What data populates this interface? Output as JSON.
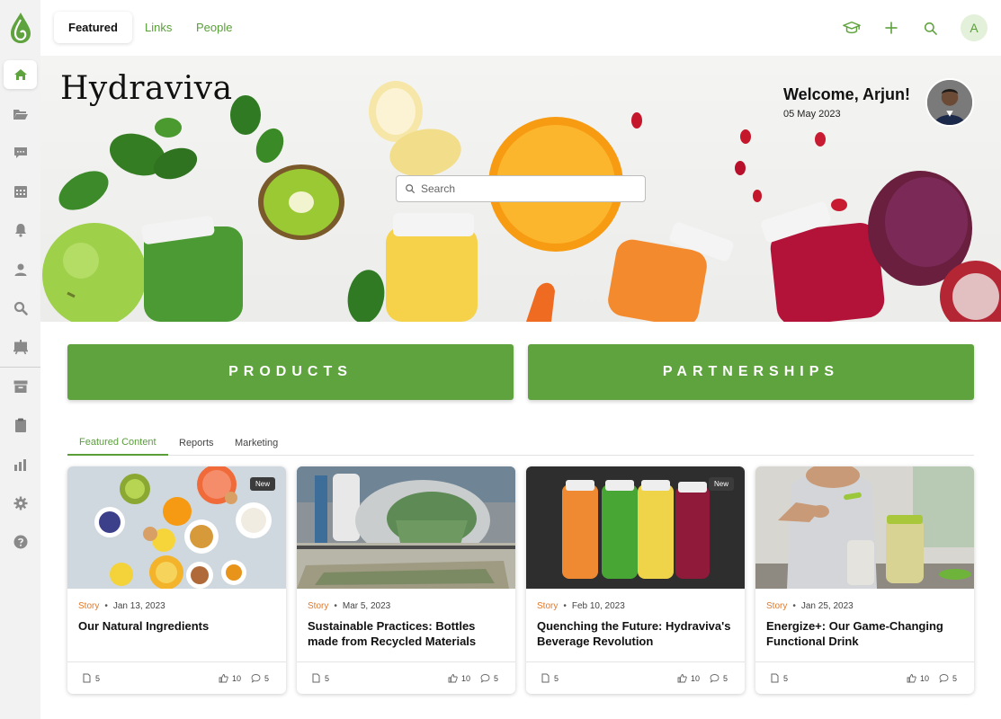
{
  "topbar": {
    "tabs": [
      {
        "label": "Featured"
      },
      {
        "label": "Links"
      },
      {
        "label": "People"
      }
    ],
    "avatar_initial": "A"
  },
  "hero": {
    "brand": "Hydraviva",
    "welcome": "Welcome, Arjun!",
    "date": "05 May 2023",
    "search_placeholder": "Search"
  },
  "buttons": {
    "products": "PRODUCTS",
    "partnerships": "PARTNERSHIPS"
  },
  "content_tabs": [
    {
      "label": "Featured Content"
    },
    {
      "label": "Reports"
    },
    {
      "label": "Marketing"
    }
  ],
  "cards": [
    {
      "type": "Story",
      "date": "Jan 13, 2023",
      "title": "Our Natural Ingredients",
      "badge": "New",
      "docs": "5",
      "likes": "10",
      "comments": "5"
    },
    {
      "type": "Story",
      "date": "Mar 5, 2023",
      "title": "Sustainable Practices: Bottles made from Recycled Materials",
      "badge": "",
      "docs": "5",
      "likes": "10",
      "comments": "5"
    },
    {
      "type": "Story",
      "date": "Feb 10, 2023",
      "title": "Quenching the Future: Hydraviva's Beverage Revolution",
      "badge": "New",
      "docs": "5",
      "likes": "10",
      "comments": "5"
    },
    {
      "type": "Story",
      "date": "Jan 25, 2023",
      "title": "Energize+: Our Game-Changing Functional Drink",
      "badge": "",
      "docs": "5",
      "likes": "10",
      "comments": "5"
    }
  ],
  "colors": {
    "accent": "#5fa33e",
    "story": "#e07a2c",
    "sidebar_bg": "#f2f2f2"
  }
}
